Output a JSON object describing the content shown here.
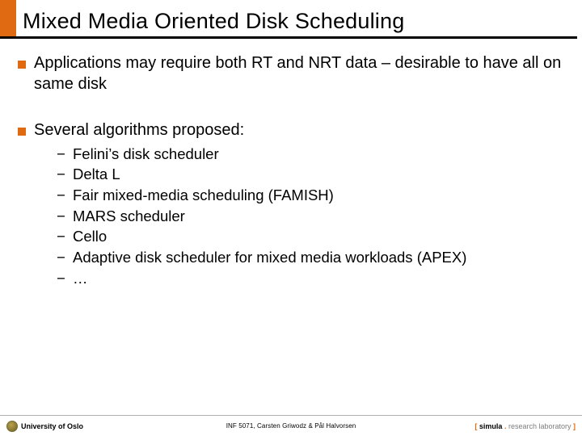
{
  "title": "Mixed Media Oriented Disk Scheduling",
  "bullets": [
    {
      "text": "Applications may require both RT and NRT data – desirable to have all on same disk"
    },
    {
      "text": "Several algorithms proposed:",
      "subs": [
        "Felini’s disk scheduler",
        "Delta L",
        "Fair mixed-media scheduling (FAMISH)",
        "MARS scheduler",
        "Cello",
        "Adaptive disk scheduler for mixed media workloads (APEX)",
        "…"
      ]
    }
  ],
  "footer": {
    "left": "University of Oslo",
    "center": "INF 5071, Carsten Griwodz & Pål Halvorsen",
    "right": {
      "open": "[ ",
      "brand": "simula",
      "dot": " . ",
      "rest": "research laboratory",
      "close": " ]"
    }
  }
}
